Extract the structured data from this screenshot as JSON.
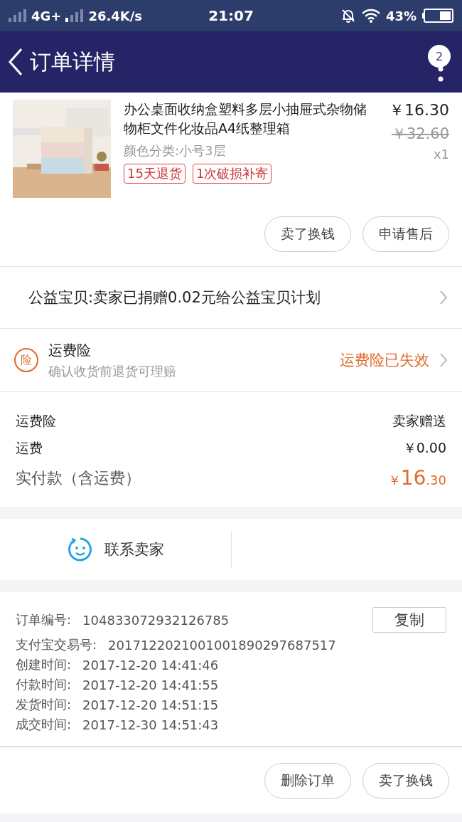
{
  "status_bar": {
    "network": "4G+",
    "speed": "26.4K/s",
    "time": "21:07",
    "battery": "43%"
  },
  "header": {
    "title": "订单详情",
    "badge": "2"
  },
  "product": {
    "kind": "picture",
    "title": "办公桌面收纳盒塑料多层小抽屉式杂物储物柜文件化妆品A4纸整理箱",
    "variant": "颜色分类:小号3层",
    "price": "￥16.30",
    "original_price": "￥32.60",
    "quantity": "x1",
    "tags": [
      "15天退货",
      "1次破损补寄"
    ],
    "buttons": [
      "卖了换钱",
      "申请售后"
    ]
  },
  "charity": {
    "text": "公益宝贝:卖家已捐赠0.02元给公益宝贝计划"
  },
  "insurance": {
    "icon_text": "险",
    "title": "运费险",
    "subtitle": "确认收货前退货可理赔",
    "status": "运费险已失效"
  },
  "summary": {
    "rows": [
      {
        "label": "运费险",
        "value": "卖家赠送"
      },
      {
        "label": "运费",
        "value": "￥0.00"
      }
    ],
    "total": {
      "label": "实付款（含运费）",
      "symbol": "￥",
      "whole": "16",
      "fraction": ".30"
    }
  },
  "contact": {
    "label": "联系卖家"
  },
  "order_info": {
    "rows": [
      {
        "label": "订单编号:",
        "value": "104833072932126785"
      },
      {
        "label": "支付宝交易号:",
        "value": "2017122021001001890297687517"
      },
      {
        "label": "创建时间:",
        "value": "2017-12-20 14:41:46"
      },
      {
        "label": "付款时间:",
        "value": "2017-12-20 14:41:55"
      },
      {
        "label": "发货时间:",
        "value": "2017-12-20 14:51:15"
      },
      {
        "label": "成交时间:",
        "value": "2017-12-30 14:51:43"
      }
    ],
    "copy_button": "复制"
  },
  "footer": {
    "buttons": [
      "删除订单",
      "卖了换钱"
    ]
  }
}
